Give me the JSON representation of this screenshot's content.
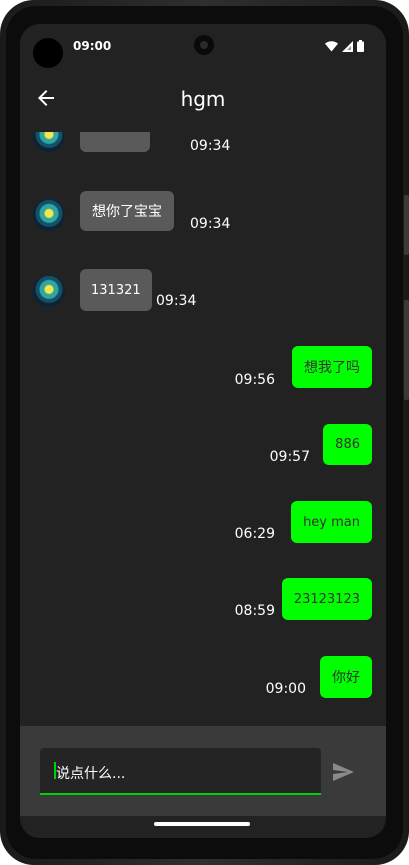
{
  "status_bar": {
    "time": "09:00"
  },
  "app_bar": {
    "title": "hgm"
  },
  "messages": [
    {
      "dir": "in",
      "text": "",
      "time": "09:34"
    },
    {
      "dir": "in",
      "text": "想你了宝宝",
      "time": "09:34"
    },
    {
      "dir": "in",
      "text": "131321",
      "time": "09:34"
    },
    {
      "dir": "out",
      "text": "想我了吗",
      "time": "09:56"
    },
    {
      "dir": "out",
      "text": "886",
      "time": "09:57"
    },
    {
      "dir": "out",
      "text": "hey man",
      "time": "06:29"
    },
    {
      "dir": "out",
      "text": "23123123",
      "time": "08:59"
    },
    {
      "dir": "out",
      "text": "你好",
      "time": "09:00"
    }
  ],
  "input": {
    "placeholder": "说点什么..."
  },
  "colors": {
    "sent_bubble": "#00ff00",
    "received_bubble": "#5a5a5a",
    "background": "#222222",
    "accent": "#00d100"
  },
  "icons": {
    "back": "arrow-left-icon",
    "send": "send-icon",
    "wifi": "wifi-icon",
    "signal": "signal-icon",
    "battery": "battery-icon"
  }
}
